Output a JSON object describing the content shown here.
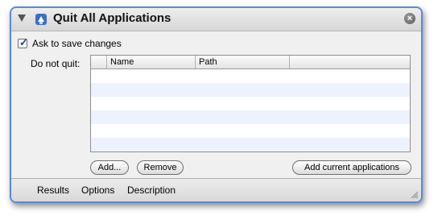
{
  "action": {
    "title": "Quit All Applications",
    "icon": "automator-app-icon",
    "close_glyph": "×"
  },
  "options": {
    "ask_to_save": {
      "label": "Ask to save changes",
      "checked": true
    }
  },
  "do_not_quit": {
    "label": "Do not quit:",
    "columns": [
      "",
      "Name",
      "Path",
      ""
    ],
    "rows": []
  },
  "buttons": {
    "add": "Add...",
    "remove": "Remove",
    "add_current": "Add current applications"
  },
  "footer": {
    "tabs": [
      "Results",
      "Options",
      "Description"
    ]
  },
  "colors": {
    "border": "#5b8ad0",
    "row_stripe": "#edf3fe"
  }
}
